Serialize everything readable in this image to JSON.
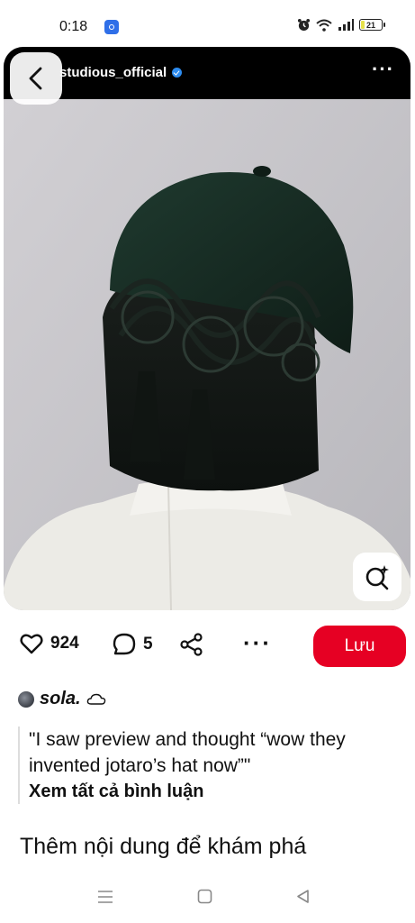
{
  "status_bar": {
    "time": "0:18",
    "battery": "21",
    "battery_fraction": 0.21,
    "icons": [
      "notification-app-icon",
      "alarm-icon",
      "wifi-icon",
      "signal-icon",
      "battery-icon"
    ]
  },
  "pin": {
    "username": "studious_official",
    "verified": true,
    "menu_icon": "more-horizontal-icon",
    "back_icon": "back-arrow-icon",
    "lens_icon": "visual-search-icon"
  },
  "actions": {
    "likes": "924",
    "comments": "5",
    "save_label": "Lưu",
    "save_color": "#e60023"
  },
  "comment": {
    "author": "sola.",
    "text": "\"I saw preview and thought “wow they invented jotaro’s hat now”\"",
    "see_all": "Xem tất cả bình luận"
  },
  "more_section": {
    "title": "Thêm nội dung để khám phá"
  },
  "nav_bar": {
    "icons": [
      "menu-icon",
      "home-icon",
      "back-icon"
    ]
  }
}
